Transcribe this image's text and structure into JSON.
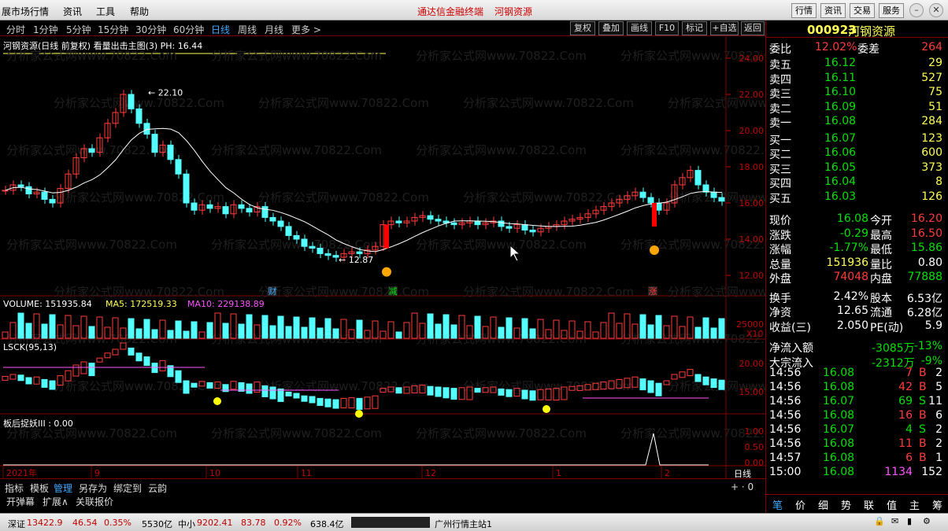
{
  "menubar": {
    "app_name": "展市场行情",
    "menus": [
      "资讯",
      "工具",
      "帮助"
    ],
    "center_title": "通达信金融终端",
    "center_stock": "河钢资源",
    "right_buttons": [
      "行情",
      "资讯",
      "交易",
      "服务"
    ]
  },
  "period_tabs": [
    "分时",
    "1分钟",
    "5分钟",
    "15分钟",
    "30分钟",
    "60分钟",
    "日线",
    "周线",
    "月线",
    "更多 >"
  ],
  "active_period": "日线",
  "toolbar_buttons": [
    "复权",
    "叠加",
    "画线",
    "F10",
    "标记",
    "+自选",
    "返回"
  ],
  "chart": {
    "title_line": "河钢资源(日线 前复权) 看量出击主图(3)  PH: 16.44",
    "price_axis": [
      "24.00",
      "22.00",
      "20.00",
      "18.00",
      "16.00",
      "14.00",
      "12.00"
    ],
    "high_label": "22.10",
    "low_label": "12.87",
    "event_markers": [
      "财",
      "减",
      "涨"
    ],
    "volume_title": "VOLUME: 151935.84",
    "volume_ma5": "MA5: 172519.33",
    "volume_ma10": "MA10: 229138.89",
    "volume_axis": "25000",
    "volume_unit": "X10",
    "lsck_title": "LSCK(95,13)",
    "lsck_axis": [
      "20.00",
      "15.00"
    ],
    "ind3_title": "板后捉妖III : 0.00",
    "ind3_axis": [
      "1.00",
      "0.50",
      "0.00"
    ],
    "date_axis": [
      "2021年",
      "9",
      "10",
      "11",
      "12",
      "1",
      "2"
    ],
    "watermark": "分析家公式网www.70822.Com",
    "period_label": "日线"
  },
  "bottom_tabs": [
    "指标",
    "模板",
    "管理",
    "另存为",
    "绑定到",
    "云韵"
  ],
  "bottom_tabs2": [
    "开弹幕",
    "扩展∧",
    "关联报价"
  ],
  "quote": {
    "code": "000923",
    "name": "河钢资源",
    "weibi_label": "委比",
    "weibi": "12.02%",
    "weicha_label": "委差",
    "weicha": "264",
    "sell": [
      [
        "卖五",
        "16.12",
        "29"
      ],
      [
        "卖四",
        "16.11",
        "527"
      ],
      [
        "卖三",
        "16.10",
        "75"
      ],
      [
        "卖二",
        "16.09",
        "51"
      ],
      [
        "卖一",
        "16.08",
        "284"
      ]
    ],
    "buy": [
      [
        "买一",
        "16.07",
        "123"
      ],
      [
        "买二",
        "16.06",
        "600"
      ],
      [
        "买三",
        "16.05",
        "373"
      ],
      [
        "买四",
        "16.04",
        "8"
      ],
      [
        "买五",
        "16.03",
        "126"
      ]
    ],
    "stats": [
      [
        "现价",
        "16.08",
        "今开",
        "16.20"
      ],
      [
        "涨跌",
        "-0.29",
        "最高",
        "16.50"
      ],
      [
        "涨幅",
        "-1.77%",
        "最低",
        "15.86"
      ],
      [
        "总量",
        "151936",
        "量比",
        "0.80"
      ],
      [
        "外盘",
        "74048",
        "内盘",
        "77888"
      ]
    ],
    "stats2": [
      [
        "换手",
        "2.42%",
        "股本",
        "6.53亿"
      ],
      [
        "净资",
        "12.65",
        "流通",
        "6.28亿"
      ],
      [
        "收益(三)",
        "2.050",
        "PE(动)",
        "5.9"
      ]
    ],
    "flow": [
      [
        "净流入额",
        "-3085万",
        "-13%"
      ],
      [
        "大宗流入",
        "-2312万",
        "-9%"
      ]
    ],
    "ticks": [
      [
        "14:56",
        "16.08",
        "7",
        "B",
        "2"
      ],
      [
        "14:56",
        "16.08",
        "42",
        "B",
        "5"
      ],
      [
        "14:56",
        "16.07",
        "69",
        "S",
        "11"
      ],
      [
        "14:56",
        "16.08",
        "16",
        "B",
        "6"
      ],
      [
        "14:56",
        "16.07",
        "4",
        "S",
        "2"
      ],
      [
        "14:56",
        "16.08",
        "11",
        "B",
        "2"
      ],
      [
        "14:57",
        "16.08",
        "6",
        "B",
        "1"
      ],
      [
        "15:00",
        "16.08",
        "1134",
        "",
        "152"
      ]
    ],
    "panel_tabs": [
      "笔",
      "价",
      "细",
      "势",
      "联",
      "值",
      "主",
      "筹"
    ]
  },
  "status": {
    "sz_label": "深证",
    "sz_val": "13422.9",
    "sz_chg": "46.54",
    "sz_pct": "0.35%",
    "sz_amt": "5530亿",
    "zx_label": "中小",
    "zx_val": "9202.41",
    "zx_chg": "83.78",
    "zx_pct": "0.92%",
    "zx_amt": "638.4亿",
    "server": "广州行情主站1"
  },
  "colors": {
    "up": "#ff3c3c",
    "down": "#54ffff",
    "ma": "#ffffff",
    "accent": "#ffff54",
    "border": "#800000"
  }
}
